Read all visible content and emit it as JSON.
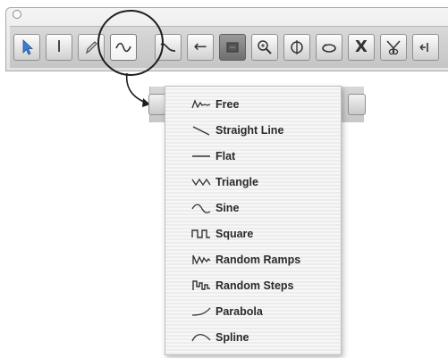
{
  "toolbar": {
    "tools": [
      {
        "name": "pointer-tool",
        "icon": "arrow-pointer-icon",
        "active": false
      },
      {
        "name": "text-cursor-tool",
        "icon": "i-beam-icon",
        "glyph": "I",
        "active": false
      },
      {
        "name": "pencil-tool",
        "icon": "pencil-icon",
        "active": false
      },
      {
        "name": "line-shape-tool",
        "icon": "sine-wave-icon",
        "active": true
      },
      {
        "name": "curve-tool",
        "icon": "curve-icon",
        "active": false
      },
      {
        "name": "nudge-left-tool",
        "icon": "left-arrow-icon",
        "glyph": "←",
        "active": false
      },
      {
        "name": "grabber-tool",
        "icon": "grabber-icon",
        "active": false
      },
      {
        "name": "zoom-tool",
        "icon": "magnifier-icon",
        "active": false
      },
      {
        "name": "scrub-tool",
        "icon": "scrub-icon",
        "active": false
      },
      {
        "name": "loop-tool",
        "icon": "loop-icon",
        "active": false
      },
      {
        "name": "mute-tool",
        "icon": "x-icon",
        "glyph": "X",
        "active": false
      },
      {
        "name": "scissors-tool",
        "icon": "scissors-icon",
        "active": false
      },
      {
        "name": "glue-tool",
        "icon": "glue-icon",
        "active": false
      }
    ]
  },
  "menu": {
    "items": [
      {
        "id": "free",
        "label": "Free",
        "icon": "freehand-line-icon"
      },
      {
        "id": "straight-line",
        "label": "Straight Line",
        "icon": "straight-line-icon"
      },
      {
        "id": "flat",
        "label": "Flat",
        "icon": "flat-line-icon"
      },
      {
        "id": "triangle",
        "label": "Triangle",
        "icon": "triangle-wave-icon"
      },
      {
        "id": "sine",
        "label": "Sine",
        "icon": "sine-wave-icon"
      },
      {
        "id": "square",
        "label": "Square",
        "icon": "square-wave-icon"
      },
      {
        "id": "random-ramps",
        "label": "Random Ramps",
        "icon": "random-ramps-icon"
      },
      {
        "id": "random-steps",
        "label": "Random Steps",
        "icon": "random-steps-icon"
      },
      {
        "id": "parabola",
        "label": "Parabola",
        "icon": "parabola-icon"
      },
      {
        "id": "spline",
        "label": "Spline",
        "icon": "spline-icon"
      }
    ]
  },
  "colors": {
    "pointer_blue": "#3a7fd6",
    "icon_stroke": "#333333",
    "highlight_circle": "#1e1e1e"
  }
}
